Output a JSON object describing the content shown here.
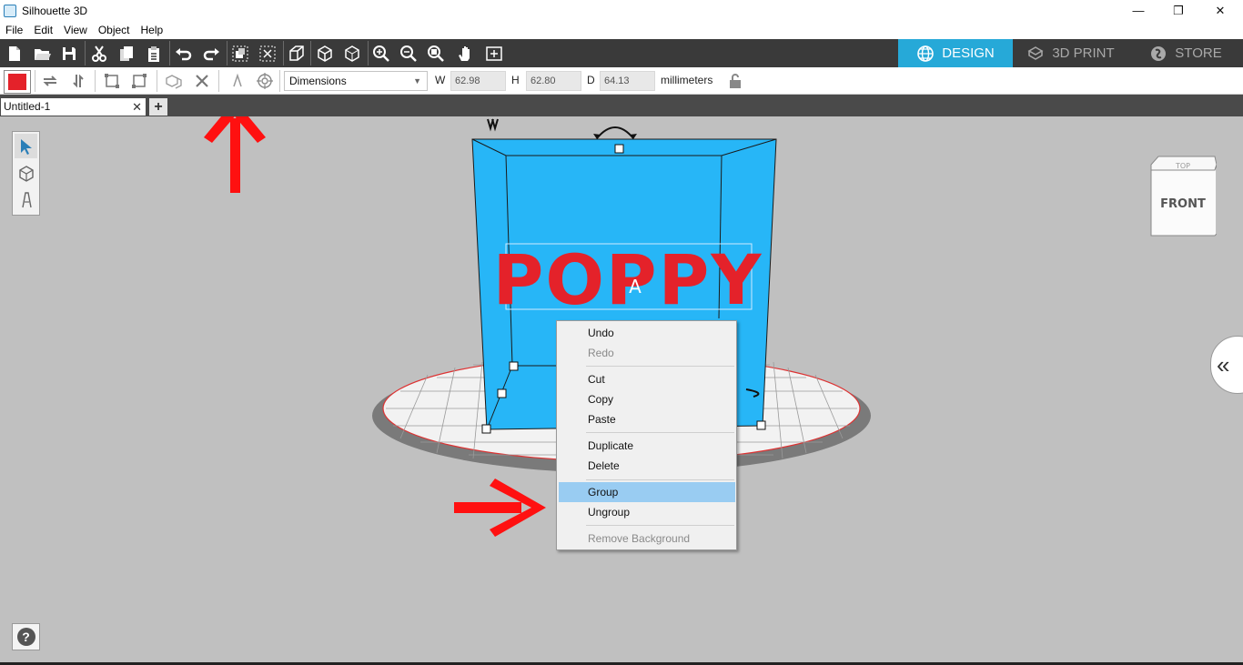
{
  "window": {
    "title": "Silhouette 3D",
    "minimize_glyph": "—",
    "restore_glyph": "❐",
    "close_glyph": "✕"
  },
  "menu": [
    "File",
    "Edit",
    "View",
    "Object",
    "Help"
  ],
  "mode_tabs": {
    "design": "DESIGN",
    "print": "3D PRINT",
    "store": "STORE"
  },
  "properties": {
    "dimensions_select": "Dimensions",
    "w_label": "W",
    "w_value": "62.98",
    "h_label": "H",
    "h_value": "62.80",
    "d_label": "D",
    "d_value": "64.13",
    "units": "millimeters",
    "fill_color": "#e4222a"
  },
  "document_tab": {
    "name": "Untitled-1",
    "close_glyph": "✕",
    "add_glyph": "+"
  },
  "viewcube": {
    "face_front": "FRONT",
    "face_top": "TOP"
  },
  "scene": {
    "text_object": "POPPY",
    "box_color": "#29b6f6",
    "text_color": "#e4222a"
  },
  "context_menu": {
    "undo": "Undo",
    "redo": "Redo",
    "cut": "Cut",
    "copy": "Copy",
    "paste": "Paste",
    "duplicate": "Duplicate",
    "delete": "Delete",
    "group": "Group",
    "ungroup": "Ungroup",
    "remove_background": "Remove Background"
  },
  "help_glyph": "?",
  "collapse_glyph": "«"
}
